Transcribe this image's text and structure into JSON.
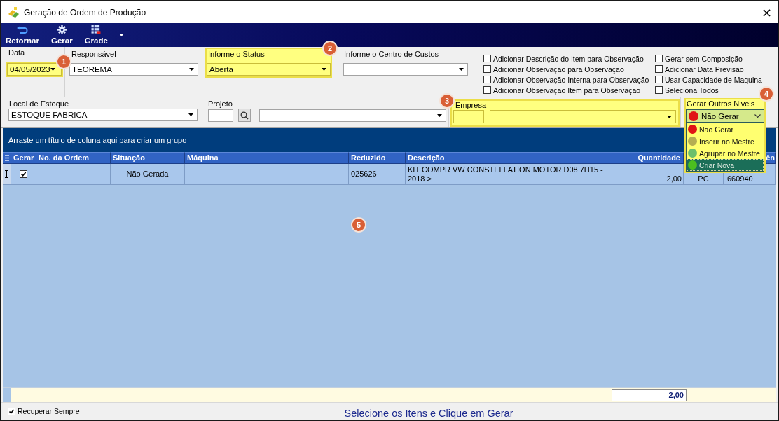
{
  "window": {
    "title": "Geração de Ordem de Produção",
    "close": "×"
  },
  "toolbar": {
    "buttons": [
      {
        "kind": "back",
        "label": "Retornar"
      },
      {
        "kind": "gear",
        "label": "Gerar"
      },
      {
        "kind": "grid",
        "label": "Grade"
      }
    ]
  },
  "filters": {
    "data": {
      "label": "Data",
      "value": "04/05/2023",
      "highlighted": true,
      "callout": "1"
    },
    "responsavel": {
      "label": "Responsável",
      "value": "TEOREMA",
      "highlighted": false
    },
    "status": {
      "label": "Informe o Status",
      "value": "Aberta",
      "highlighted": true,
      "callout": "2"
    },
    "centro_de_custos": {
      "label": "Informe o Centro de Custos",
      "highlighted": false
    },
    "options": [
      {
        "label": "Adicionar Descrição do Item para Observação",
        "checked": false
      },
      {
        "label": "Adicionar Observação para Observação",
        "checked": false
      },
      {
        "label": "Adicionar Observação Interna para Observação",
        "checked": false
      },
      {
        "label": "Adicionar Observação Item para Observação",
        "checked": false
      },
      {
        "label": "Gerar sem Composição",
        "checked": false
      },
      {
        "label": "Adicionar Data Previsão",
        "checked": false
      },
      {
        "label": "Usar Capacidade de Maquina",
        "checked": false
      },
      {
        "label": "Seleciona Todos",
        "checked": false
      }
    ],
    "local_de_estoque": {
      "label": "Local de Estoque",
      "value": "ESTOQUE FABRICA",
      "highlighted": false
    },
    "projeto": {
      "label": "Projeto",
      "highlighted": false
    },
    "empresa": {
      "label": "Empresa",
      "highlighted": true,
      "callout": "3"
    },
    "gerar_outros_niveis": {
      "label": "Gerar Outros Niveis",
      "highlighted": true,
      "callout": "4",
      "expanded": true,
      "current": {
        "label": "Não Gerar",
        "color": "#e01515"
      },
      "options": [
        {
          "label": "Não Gerar",
          "color": "#e01515",
          "selected": false
        },
        {
          "label": "Inserir no Mestre",
          "color": "#b4ae52",
          "selected": false
        },
        {
          "label": "Agrupar no Mestre",
          "color": "#6bbf6b",
          "selected": false
        },
        {
          "label": "Criar Nova",
          "color": "#4cbf1f",
          "selected": true
        }
      ]
    }
  },
  "grid": {
    "group_hint": "Arraste um título de coluna aqui para criar um grupo",
    "callout": "5",
    "columns": [
      {
        "label": "Gerar"
      },
      {
        "label": "No. da Ordem"
      },
      {
        "label": "Situação"
      },
      {
        "label": "Máquina"
      },
      {
        "label": "Reduzido"
      },
      {
        "label": "Descrição"
      },
      {
        "label": "Quantidade"
      },
      null,
      {
        "label": "ên"
      }
    ],
    "rows": [
      {
        "cells": [
          {
            "kind": "checkbox",
            "checked": true
          },
          null,
          {
            "kind": "text",
            "text": "Não Gerada"
          },
          null,
          {
            "kind": "text",
            "text": "025626"
          },
          {
            "kind": "text",
            "text": "KIT COMPR VW CONSTELLATION MOTOR D08 7H15 - 2018 >"
          },
          {
            "kind": "text",
            "text": "2,00"
          },
          {
            "kind": "text",
            "text": "PC"
          },
          {
            "kind": "text",
            "text": "660940"
          }
        ]
      }
    ],
    "totals": {
      "quantidade": "2,00"
    }
  },
  "status_bar": {
    "recuperar_sempre": {
      "label": "Recuperar Sempre",
      "checked": true
    },
    "message": "Selecione os Itens e Clique em Gerar"
  }
}
